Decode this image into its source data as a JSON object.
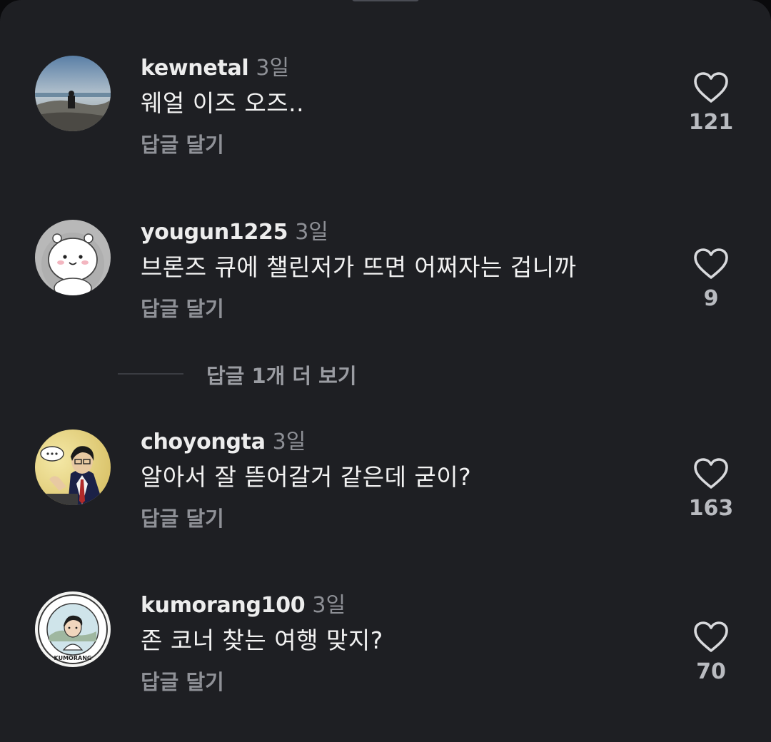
{
  "comments": [
    {
      "username": "kewnetal",
      "time": "3일",
      "text": "웨얼 이즈 오즈..",
      "reply_label": "답글 달기",
      "likes": "121"
    },
    {
      "username": "yougun1225",
      "time": "3일",
      "text": "브론즈 큐에 챌린저가 뜨면 어쩌자는 겁니까",
      "reply_label": "답글 달기",
      "likes": "9"
    },
    {
      "username": "choyongta",
      "time": "3일",
      "text": "알아서 잘 뜯어갈거 같은데 굳이?",
      "reply_label": "답글 달기",
      "likes": "163"
    },
    {
      "username": "kumorang100",
      "time": "3일",
      "text": "존 코너 찾는 여행 맞지?",
      "reply_label": "답글 달기",
      "likes": "70"
    }
  ],
  "more_replies_label": "답글 1개 더 보기",
  "avatar_logo_text": "KUMORANG",
  "icons": {
    "like": "heart-outline-icon",
    "handle": "drag-handle"
  },
  "colors": {
    "background": "#1e1f23",
    "primary_text": "#f2f2f2",
    "secondary_text": "#8f9197"
  }
}
